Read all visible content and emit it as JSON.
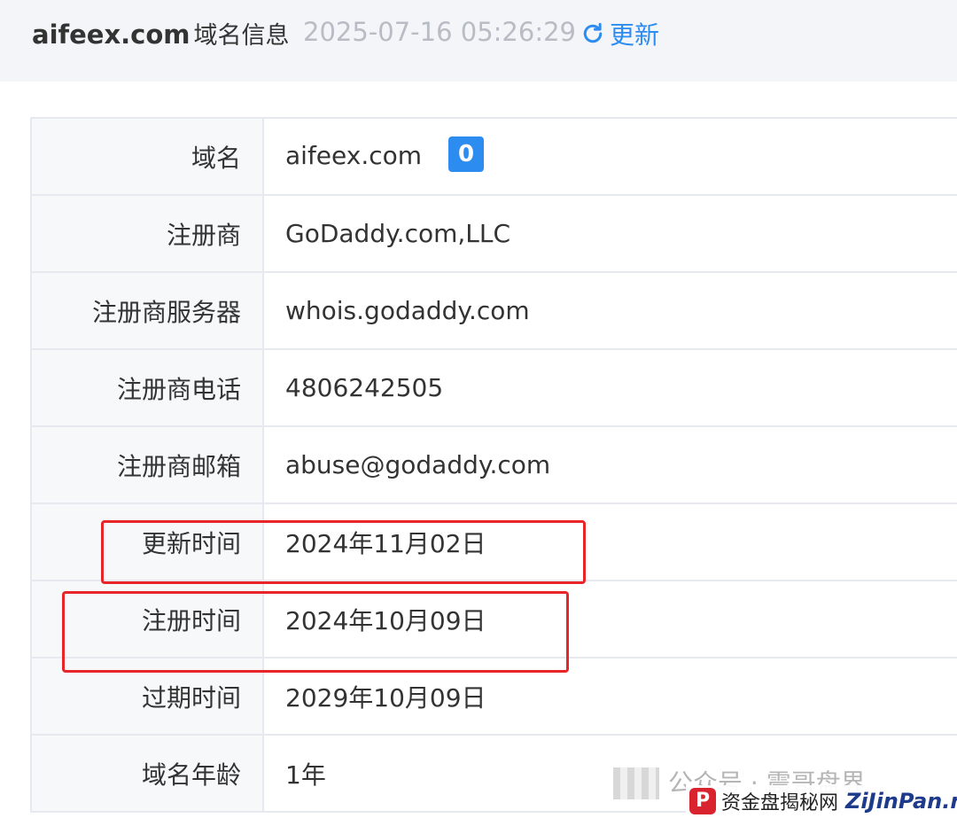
{
  "header": {
    "domain": "aifeex.com",
    "title_suffix": "域名信息",
    "timestamp": "2025-07-16 05:26:29",
    "refresh_label": "更新"
  },
  "rows": [
    {
      "label": "域名",
      "value": "aifeex.com",
      "badge": "0"
    },
    {
      "label": "注册商",
      "value": "GoDaddy.com,LLC"
    },
    {
      "label": "注册商服务器",
      "value": "whois.godaddy.com"
    },
    {
      "label": "注册商电话",
      "value": "4806242505"
    },
    {
      "label": "注册商邮箱",
      "value": "abuse@godaddy.com"
    },
    {
      "label": "更新时间",
      "value": "2024年11月02日"
    },
    {
      "label": "注册时间",
      "value": "2024年10月09日"
    },
    {
      "label": "过期时间",
      "value": "2029年10月09日"
    },
    {
      "label": "域名年龄",
      "value": "1年"
    }
  ],
  "watermark": {
    "line1": "公众号 · 震哥盘界",
    "logo": "P",
    "site_cn": "资金盘揭秘网",
    "site_en": "ZiJinPan.net"
  },
  "colors": {
    "accent": "#2d8cf0",
    "highlight": "#e8262a",
    "header_bg": "#f3f5f8"
  }
}
